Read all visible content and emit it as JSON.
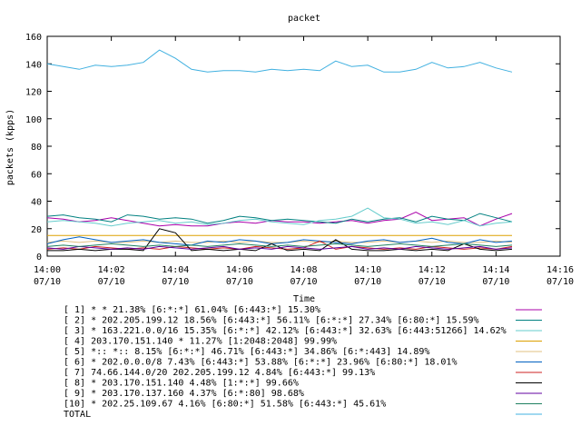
{
  "chart_data": {
    "type": "line",
    "title": "packet",
    "xlabel": "Time",
    "ylabel": "packets (kpps)",
    "ylim": [
      0,
      160
    ],
    "xlim": [
      "14:00",
      "14:16"
    ],
    "yticks": [
      "0",
      "20",
      "40",
      "60",
      "80",
      "100",
      "120",
      "140",
      "160"
    ],
    "xticks": [
      {
        "time": "14:00",
        "date": "07/10"
      },
      {
        "time": "14:02",
        "date": "07/10"
      },
      {
        "time": "14:04",
        "date": "07/10"
      },
      {
        "time": "14:06",
        "date": "07/10"
      },
      {
        "time": "14:08",
        "date": "07/10"
      },
      {
        "time": "14:10",
        "date": "07/10"
      },
      {
        "time": "14:12",
        "date": "07/10"
      },
      {
        "time": "14:14",
        "date": "07/10"
      },
      {
        "time": "14:16",
        "date": "07/10"
      }
    ],
    "grid": false,
    "legend_position": "bottom",
    "x": [
      "14:00",
      "14:00:30",
      "14:01",
      "14:01:30",
      "14:02",
      "14:02:30",
      "14:03",
      "14:03:30",
      "14:04",
      "14:04:30",
      "14:05",
      "14:05:30",
      "14:06",
      "14:06:30",
      "14:07",
      "14:07:30",
      "14:08",
      "14:08:30",
      "14:09",
      "14:09:30",
      "14:10",
      "14:10:30",
      "14:11",
      "14:11:30",
      "14:12",
      "14:12:30",
      "14:13",
      "14:13:30",
      "14:14",
      "14:14:30"
    ],
    "series": [
      {
        "name": "[ 1] * * 21.38%  [6:*:*] 61.04% [6:443:*] 15.30%",
        "color": "#aa00aa",
        "values": [
          28,
          27,
          25,
          26,
          28,
          26,
          24,
          22,
          23,
          22,
          22,
          24,
          25,
          24,
          26,
          25,
          25,
          24,
          25,
          26,
          24,
          26,
          27,
          32,
          26,
          27,
          28,
          22,
          27,
          31
        ]
      },
      {
        "name": "[ 2] * 202.205.199.12 18.56%  [6:443:*] 56.11% [6:*:*] 27.34% [6:80:*] 15.59%",
        "color": "#008080",
        "values": [
          29,
          30,
          28,
          27,
          25,
          30,
          29,
          27,
          28,
          27,
          24,
          26,
          29,
          28,
          26,
          27,
          26,
          25,
          24,
          27,
          25,
          27,
          28,
          25,
          29,
          27,
          26,
          31,
          28,
          25
        ]
      },
      {
        "name": "[ 3] * 163.221.0.0/16 15.35%  [6:*:*] 42.12% [6:443:*] 32.63% [6:443:51266] 14.62%",
        "color": "#66cccc",
        "values": [
          25,
          26,
          25,
          24,
          22,
          24,
          25,
          26,
          24,
          25,
          23,
          24,
          26,
          27,
          25,
          24,
          23,
          26,
          27,
          29,
          35,
          28,
          27,
          24,
          25,
          23,
          26,
          22,
          24,
          25
        ]
      },
      {
        "name": "[ 4] 203.170.151.140 * 11.27%  [1:2048:2048] 99.99%",
        "color": "#dda000",
        "values": [
          15,
          15,
          15,
          15,
          15,
          15,
          15,
          15,
          15,
          15,
          15,
          15,
          15,
          15,
          15,
          15,
          15,
          15,
          15,
          15,
          15,
          15,
          15,
          15,
          15,
          15,
          15,
          15,
          15,
          15
        ]
      },
      {
        "name": "[ 5] *:: *:: 8.15%  [6:*:*] 46.71% [6:443:*] 34.86% [6:*:443] 14.89%",
        "color": "#e0c080",
        "values": [
          10,
          11,
          10,
          11,
          10,
          10,
          11,
          10,
          11,
          10,
          10,
          11,
          10,
          11,
          10,
          10,
          11,
          10,
          11,
          10,
          10,
          11,
          10,
          11,
          10,
          11,
          10,
          10,
          11,
          10
        ]
      },
      {
        "name": "[ 6] * 202.0.0.0/8 7.43%  [6:443:*] 53.88% [6:*:*] 23.96% [6:80:*] 18.01%",
        "color": "#0060c0",
        "values": [
          9,
          12,
          14,
          12,
          10,
          11,
          12,
          10,
          9,
          8,
          11,
          10,
          12,
          11,
          9,
          10,
          12,
          11,
          10,
          9,
          11,
          12,
          10,
          11,
          13,
          10,
          9,
          12,
          10,
          11
        ]
      },
      {
        "name": "[ 7] 74.66.144.0/20 202.205.199.12 4.84%  [6:443:*] 99.13%",
        "color": "#cc2020",
        "values": [
          5,
          6,
          5,
          7,
          6,
          5,
          6,
          5,
          7,
          6,
          5,
          6,
          5,
          7,
          6,
          5,
          6,
          11,
          5,
          7,
          6,
          5,
          6,
          5,
          7,
          6,
          5,
          6,
          5,
          7
        ]
      },
      {
        "name": "[ 8] * 203.170.151.140 4.48%  [1:*:*] 99.66%",
        "color": "#000000",
        "values": [
          4,
          4,
          5,
          4,
          5,
          5,
          4,
          20,
          17,
          4,
          5,
          4,
          5,
          4,
          9,
          4,
          5,
          4,
          12,
          5,
          4,
          4,
          5,
          4,
          5,
          4,
          9,
          5,
          4,
          5
        ]
      },
      {
        "name": "[ 9] * 203.170.137.160 4.37%  [6:*:80] 98.68%",
        "color": "#6000a0",
        "values": [
          6,
          5,
          7,
          6,
          5,
          6,
          5,
          7,
          6,
          5,
          6,
          7,
          5,
          6,
          5,
          7,
          6,
          5,
          6,
          7,
          5,
          6,
          5,
          7,
          6,
          5,
          6,
          7,
          5,
          6
        ]
      },
      {
        "name": "[10] * 202.25.109.67 4.16%  [6:80:*] 51.58% [6:443:*] 45.61%",
        "color": "#208060",
        "values": [
          7,
          8,
          7,
          8,
          9,
          8,
          7,
          8,
          7,
          8,
          7,
          8,
          9,
          8,
          7,
          8,
          7,
          8,
          9,
          8,
          7,
          8,
          9,
          8,
          7,
          8,
          9,
          8,
          7,
          8
        ]
      },
      {
        "name": "TOTAL",
        "color": "#40b0e0",
        "values": [
          140,
          138,
          136,
          139,
          138,
          139,
          141,
          150,
          144,
          136,
          134,
          135,
          135,
          134,
          136,
          135,
          136,
          135,
          142,
          138,
          139,
          134,
          134,
          136,
          141,
          137,
          138,
          141,
          137,
          134
        ]
      }
    ]
  }
}
